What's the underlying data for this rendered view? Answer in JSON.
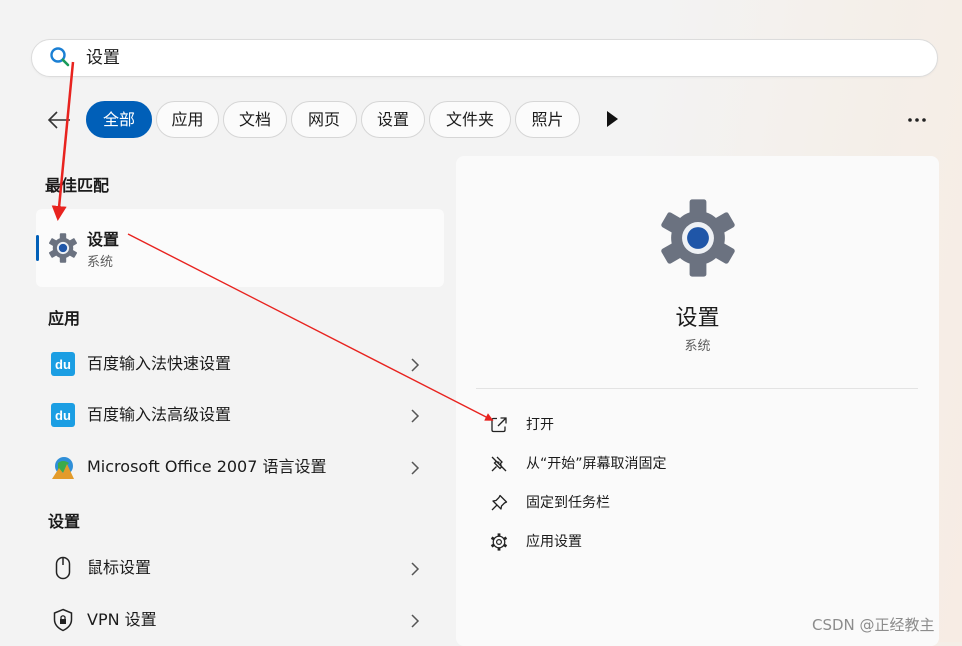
{
  "search": {
    "query": "设置"
  },
  "filters": {
    "chips": [
      {
        "label": "全部",
        "active": true
      },
      {
        "label": "应用",
        "active": false
      },
      {
        "label": "文档",
        "active": false
      },
      {
        "label": "网页",
        "active": false
      },
      {
        "label": "设置",
        "active": false
      },
      {
        "label": "文件夹",
        "active": false
      },
      {
        "label": "照片",
        "active": false
      }
    ]
  },
  "best_match": {
    "section": "最佳匹配",
    "name": "设置",
    "subtitle": "系统"
  },
  "apps": {
    "section": "应用",
    "items": [
      {
        "label": "百度输入法快速设置",
        "icon": "baidu-du-icon"
      },
      {
        "label": "百度输入法高级设置",
        "icon": "baidu-du-icon"
      },
      {
        "label": "Microsoft Office 2007 语言设置",
        "icon": "office-language-icon"
      }
    ]
  },
  "settings": {
    "section": "设置",
    "items": [
      {
        "label": "鼠标设置",
        "icon": "mouse-icon"
      },
      {
        "label": "VPN 设置",
        "icon": "shield-icon"
      }
    ]
  },
  "preview": {
    "title": "设置",
    "subtitle": "系统",
    "actions": [
      {
        "label": "打开",
        "icon": "open-external-icon"
      },
      {
        "label": "从“开始”屏幕取消固定",
        "icon": "unpin-icon"
      },
      {
        "label": "固定到任务栏",
        "icon": "pin-icon"
      },
      {
        "label": "应用设置",
        "icon": "gear-icon"
      }
    ]
  },
  "watermark": "CSDN @正经教主",
  "colors": {
    "accent": "#005fb8",
    "annotation_arrow": "#e8231f"
  }
}
